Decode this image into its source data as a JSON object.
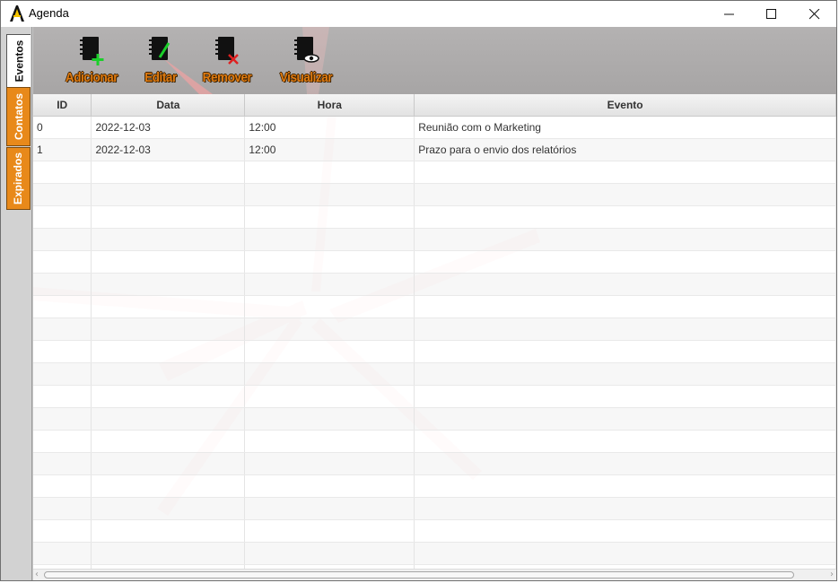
{
  "window": {
    "title": "Agenda",
    "controls": [
      "minimize-icon",
      "maximize-icon",
      "close-icon"
    ]
  },
  "sidebar": {
    "tabs": [
      {
        "label": "Eventos",
        "active": true
      },
      {
        "label": "Contatos",
        "active": false
      },
      {
        "label": "Expirados",
        "active": false
      }
    ]
  },
  "toolbar": {
    "buttons": [
      {
        "label": "Adicionar",
        "icon": "notebook-add-icon"
      },
      {
        "label": "Editar",
        "icon": "notebook-edit-icon"
      },
      {
        "label": "Remover",
        "icon": "notebook-remove-icon"
      },
      {
        "label": "Visualizar",
        "icon": "notebook-view-icon"
      }
    ]
  },
  "table": {
    "columns": [
      "ID",
      "Data",
      "Hora",
      "Evento"
    ],
    "rows": [
      [
        "0",
        "2022-12-03",
        "12:00",
        "Reunião com o Marketing"
      ],
      [
        "1",
        "2022-12-03",
        "12:00",
        "Prazo para o envio dos relatórios"
      ]
    ],
    "empty_rows": 19
  },
  "colors": {
    "tab_orange": "#e8891a",
    "toolbar_label": "#e07b10",
    "toolbar_bg": "#adabab"
  }
}
